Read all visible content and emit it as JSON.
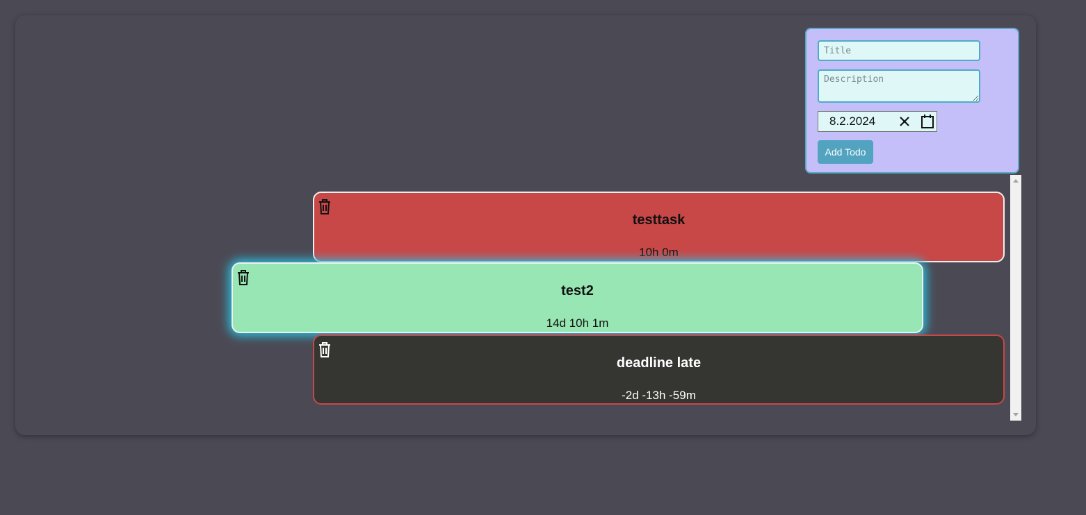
{
  "form": {
    "title_placeholder": "Title",
    "description_placeholder": "Description",
    "date_value": "8.2.2024",
    "add_button_label": "Add Todo"
  },
  "todos": [
    {
      "title": "testtask",
      "time_left": "10h 0m",
      "color": "#c84747"
    },
    {
      "title": "test2",
      "time_left": "14d 10h 1m",
      "color": "#97e6b3"
    },
    {
      "title": "deadline late",
      "time_left": "-2d -13h -59m",
      "color": "#353632"
    }
  ],
  "icons": {
    "delete": "trash-icon",
    "clear": "close-icon",
    "calendar": "calendar-icon"
  }
}
